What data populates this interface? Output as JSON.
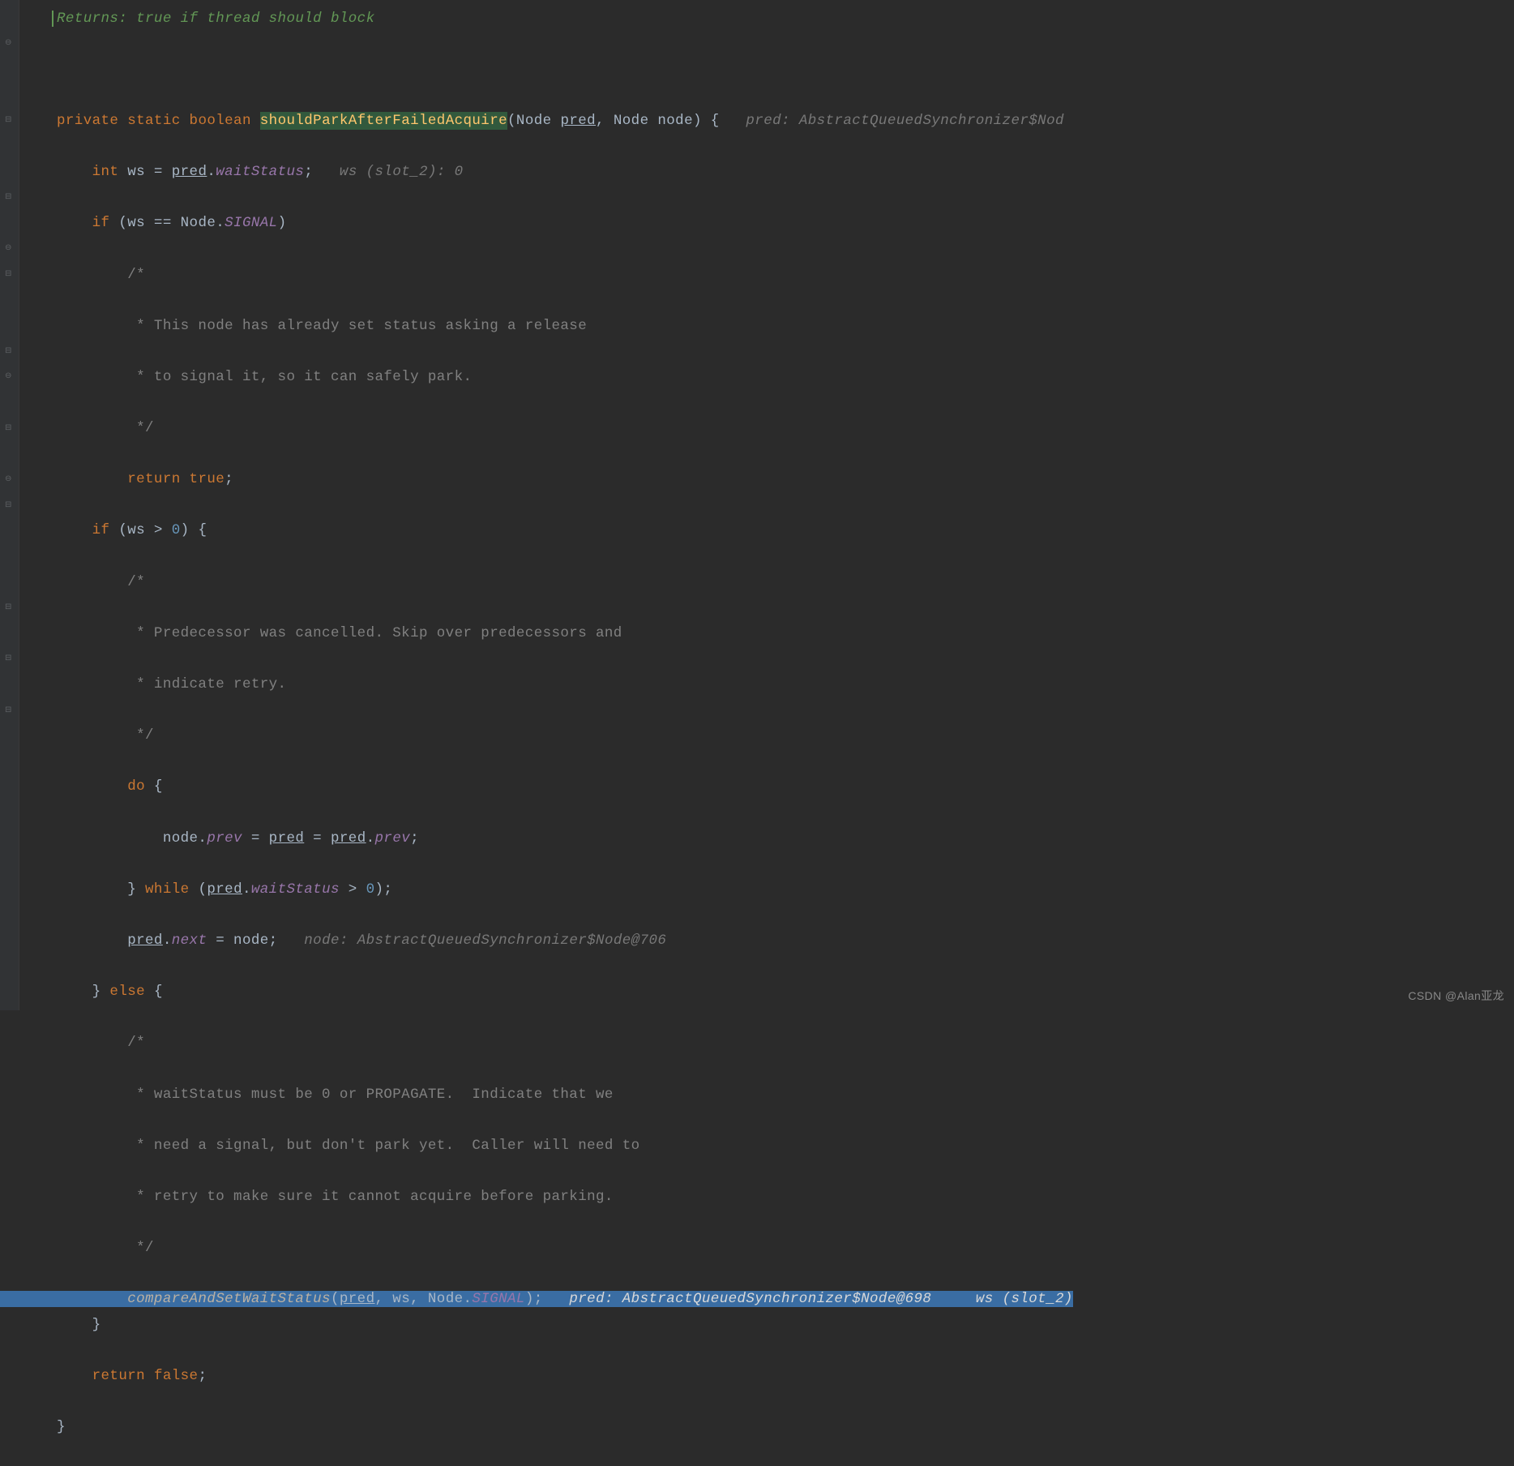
{
  "doc": {
    "returns": "Returns:",
    "returns_text": "true if thread should block"
  },
  "sig": {
    "p_private": "private",
    "p_static": "static",
    "p_boolean": "boolean",
    "method": "shouldParkAfterFailedAcquire",
    "lp": "(",
    "t_node1": "Node ",
    "pred": "pred",
    "c1": ", ",
    "t_node2": "Node node) {",
    "hint": "pred: AbstractQueuedSynchronizer$Nod"
  },
  "l1": {
    "int": "int",
    "ws": " ws = ",
    "predu": "pred",
    "dot": ".",
    "field": "waitStatus",
    "semi": ";",
    "hint": "ws (slot_2): 0"
  },
  "l2": {
    "if": "if",
    "op": " (ws == Node.",
    "sig": "SIGNAL",
    "cl": ")"
  },
  "c1a": "/*",
  "c1b": " * This node has already set status asking a release",
  "c1c": " * to signal it, so it can safely park.",
  "c1d": " */",
  "l3": {
    "return": "return",
    "true": "true",
    "semi": ";"
  },
  "l4": {
    "if": "if",
    "op": " (ws > ",
    "zero": "0",
    "cl": ") {"
  },
  "c2a": "/*",
  "c2b": " * Predecessor was cancelled. Skip over predecessors and",
  "c2c": " * indicate retry.",
  "c2d": " */",
  "l5": {
    "do": "do",
    "br": " {"
  },
  "l6": {
    "pre": "node.",
    "prev": "prev",
    "eq": " = ",
    "pred1": "pred",
    "eq2": " = ",
    "pred2": "pred",
    "dot": ".",
    "prev2": "prev",
    "semi": ";"
  },
  "l7": {
    "close": "}",
    "while": " while",
    "op": " (",
    "pred": "pred",
    "dot": ".",
    "ws": "waitStatus",
    "gt": " > ",
    "zero": "0",
    "cl": ");"
  },
  "l8": {
    "pred": "pred",
    "dot": ".",
    "next": "next",
    "eq": " = node;",
    "hint": "node: AbstractQueuedSynchronizer$Node@706"
  },
  "l9": {
    "close": "}",
    "else": " else ",
    "br": "{"
  },
  "c3a": "/*",
  "c3b": " * waitStatus must be 0 or PROPAGATE.  Indicate that we",
  "c3c": " * need a signal, but don't park yet.  Caller will need to",
  "c3d": " * retry to make sure it cannot acquire before parking.",
  "c3e": " */",
  "l10": {
    "call": "compareAndSetWaitStatus",
    "lp": "(",
    "pred": "pred",
    "c1": ", ws, Node.",
    "sig": "SIGNAL",
    "cl": ");",
    "hint1": "pred: AbstractQueuedSynchronizer$Node@698",
    "hint2": "ws (slot_2)"
  },
  "l11": {
    "close": "}"
  },
  "l12": {
    "return": "return",
    "false": "false",
    "semi": ";"
  },
  "l13": {
    "close": "}"
  },
  "watermark": "CSDN @Alan亚龙"
}
